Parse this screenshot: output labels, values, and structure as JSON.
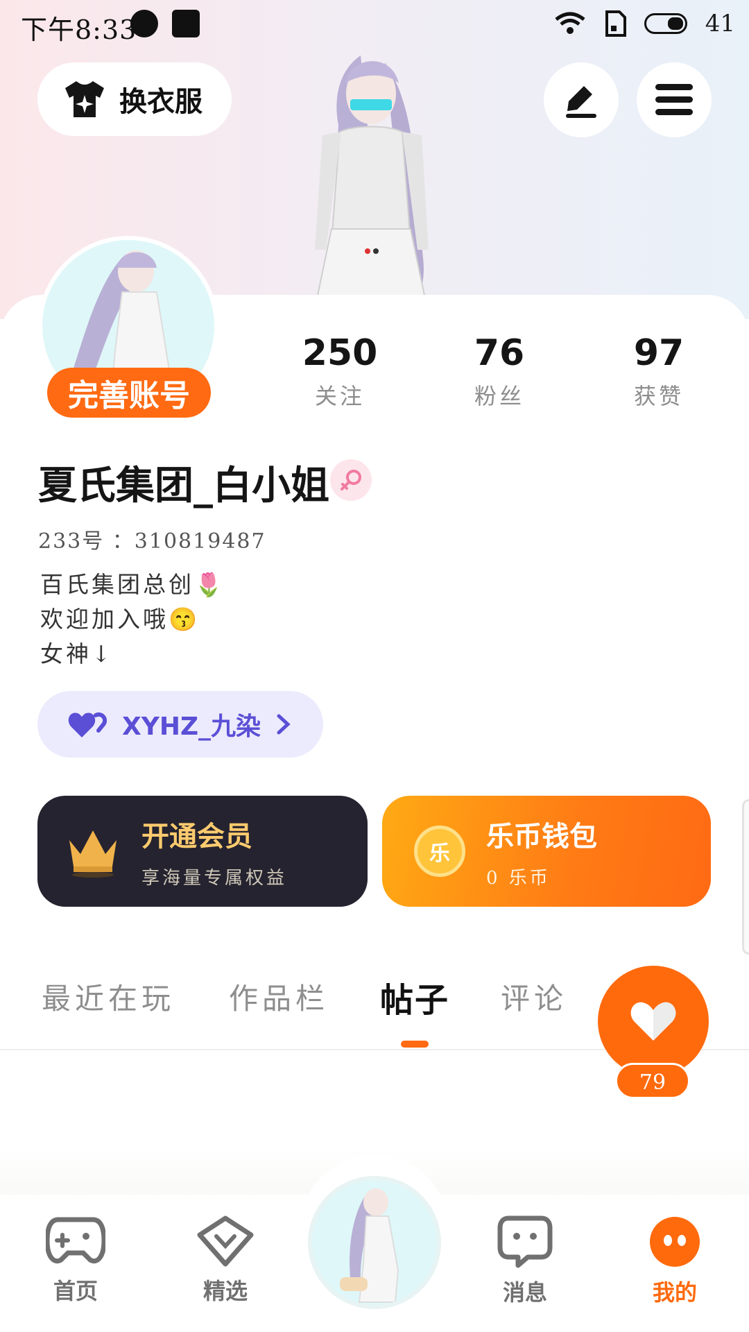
{
  "status_bar": {
    "time": "下午8:33",
    "battery": "41"
  },
  "header": {
    "dress_label": "换衣服",
    "edit_icon": "pen-icon",
    "menu_icon": "hamburger-menu-icon"
  },
  "profile": {
    "complete_label": "完善账号",
    "stats": [
      {
        "value": "250",
        "label": "关注"
      },
      {
        "value": "76",
        "label": "粉丝"
      },
      {
        "value": "97",
        "label": "获赞"
      }
    ],
    "username": "夏氏集团_白小姐",
    "gender_icon": "female-icon",
    "uid": "233号 ：310819487",
    "bio": [
      "百氏集团总创🌷",
      "欢迎加入哦😙",
      "女神↓"
    ],
    "clan": {
      "name": "XYHZ_九染"
    }
  },
  "promos": {
    "vip": {
      "title": "开通会员",
      "subtitle": "享海量专属权益"
    },
    "wallet": {
      "title": "乐币钱包",
      "subtitle": "0 乐币",
      "coin_glyph": "乐"
    }
  },
  "tabs": [
    {
      "label": "最近在玩"
    },
    {
      "label": "作品栏"
    },
    {
      "label": "帖子",
      "active": true
    },
    {
      "label": "评论"
    }
  ],
  "like_fab": {
    "count": "79"
  },
  "nav": [
    {
      "label": "首页",
      "icon": "gamepad-icon"
    },
    {
      "label": "精选",
      "icon": "heart-badge-icon"
    },
    {
      "label": "消息",
      "icon": "chat-bubble-icon"
    },
    {
      "label": "我的",
      "icon": "profile-face-icon",
      "active": true
    }
  ],
  "colors": {
    "accent": "#ff6a12",
    "vip_bg": "#25232f",
    "vip_gold": "#ffcb6e",
    "clan_purple": "#5b4fd6"
  }
}
